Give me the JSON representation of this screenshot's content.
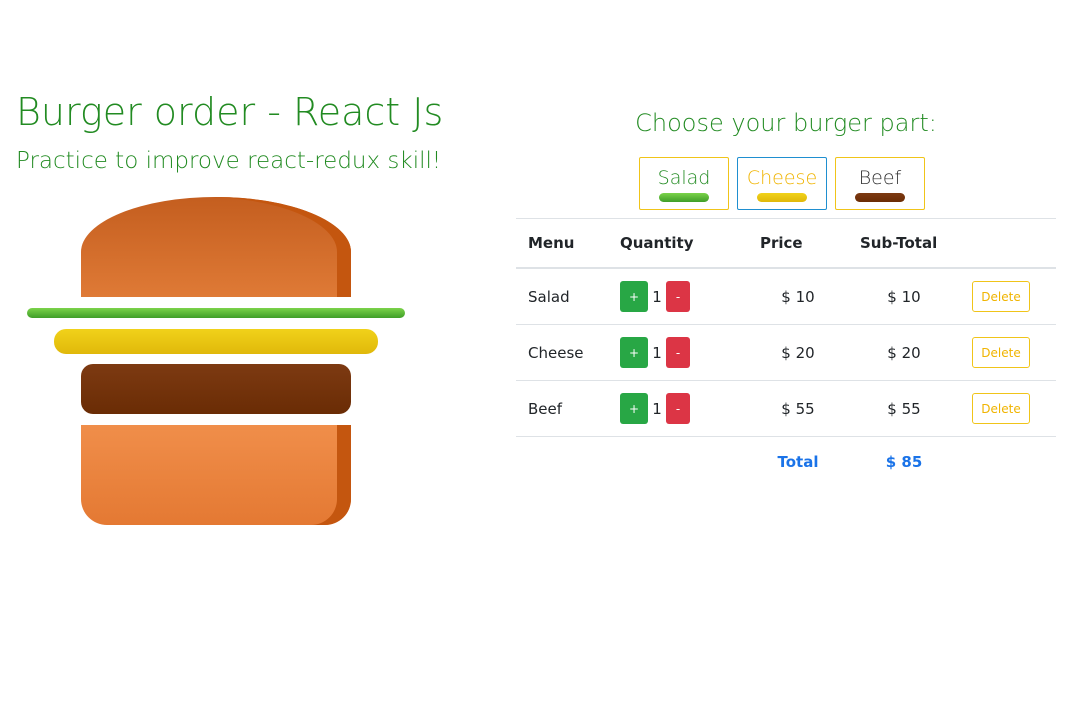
{
  "header": {
    "title": "Burger order - React Js",
    "subtitle": "Practice to improve react-redux skill!"
  },
  "chooser": {
    "title": "Choose your burger part:",
    "parts": [
      {
        "label": "Salad",
        "color": "#228b22",
        "swatch": "#4caf33",
        "active": false
      },
      {
        "label": "Cheese",
        "color": "#f0b400",
        "swatch": "#e6c012",
        "active": true
      },
      {
        "label": "Beef",
        "color": "#333333",
        "swatch": "#6a2c05",
        "active": false
      }
    ]
  },
  "table": {
    "headers": {
      "menu": "Menu",
      "quantity": "Quantity",
      "price": "Price",
      "subtotal": "Sub-Total"
    },
    "rows": [
      {
        "menu": "Salad",
        "quantity": "1",
        "price": "$ 10",
        "subtotal": "$ 10",
        "delete_label": "Delete"
      },
      {
        "menu": "Cheese",
        "quantity": "1",
        "price": "$ 20",
        "subtotal": "$ 20",
        "delete_label": "Delete"
      },
      {
        "menu": "Beef",
        "quantity": "1",
        "price": "$ 55",
        "subtotal": "$ 55",
        "delete_label": "Delete"
      }
    ],
    "plus_label": "+",
    "minus_label": "-",
    "total_label": "Total",
    "total_value": "$ 85"
  },
  "burger": {
    "layers": [
      "bread-top",
      "salad",
      "cheese",
      "beef",
      "bread-bottom"
    ],
    "colors": {
      "bread": "#e07a35",
      "salad": "#4caf33",
      "cheese": "#e6c012",
      "beef": "#6a2c05"
    }
  }
}
